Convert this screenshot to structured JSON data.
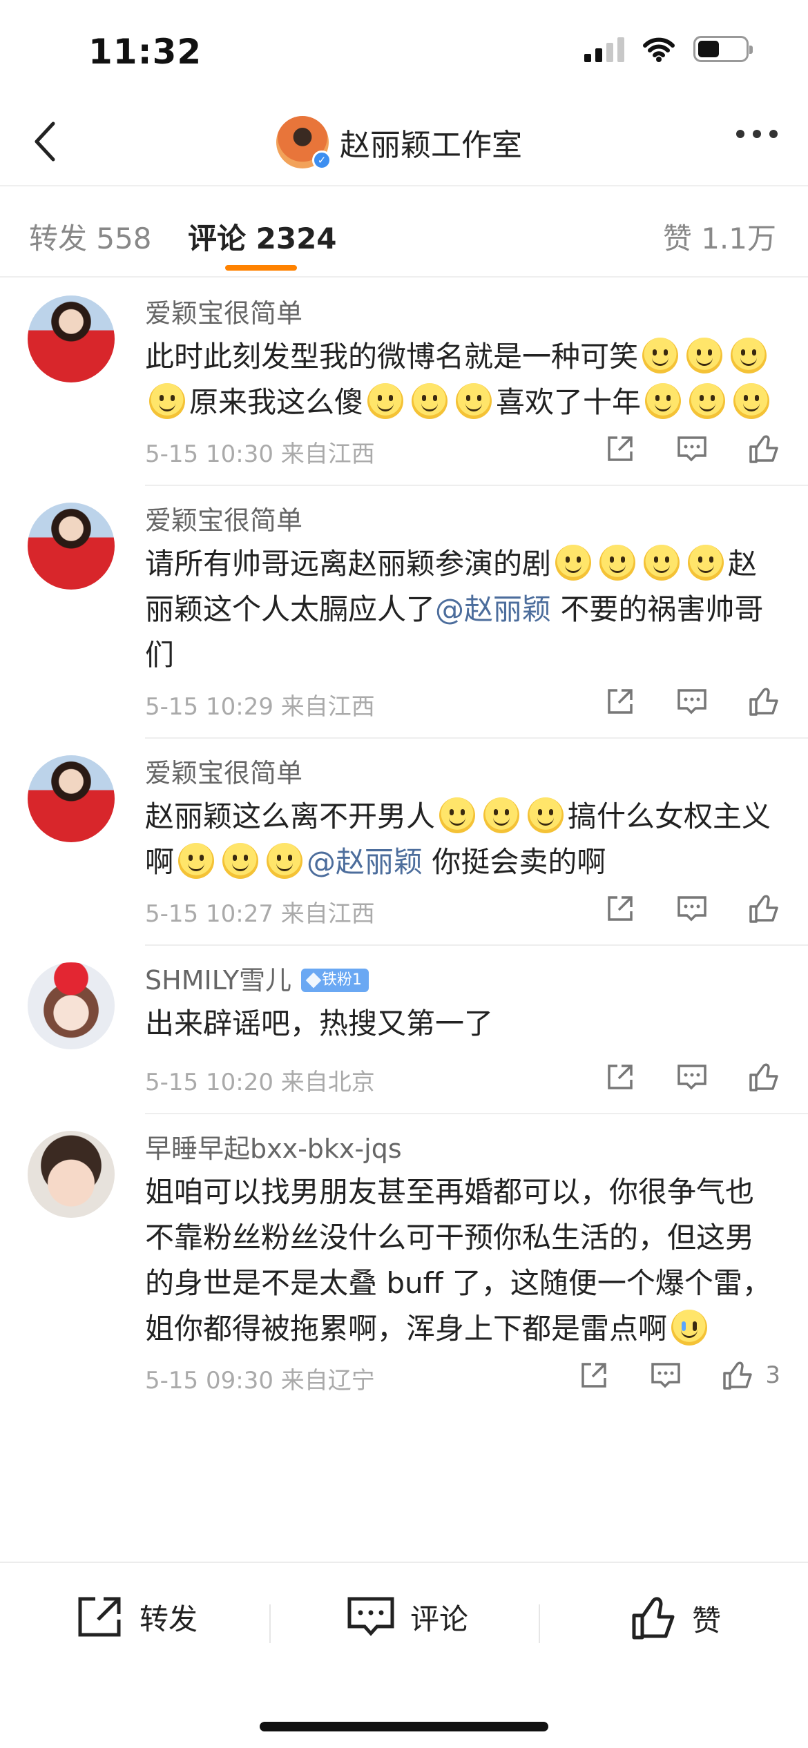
{
  "status_bar": {
    "time": "11:32"
  },
  "header": {
    "title": "赵丽颖工作室"
  },
  "tabs": {
    "forward": "转发 558",
    "comment": "评论 2324",
    "like": "赞 1.1万"
  },
  "comments": [
    {
      "username": "爱颖宝很简单",
      "segments": [
        "此时此刻发型我的微博名就是一种可笑",
        "原来我这么傻",
        "喜欢了十年"
      ],
      "meta": "5-15 10:30  来自江西"
    },
    {
      "username": "爱颖宝很简单",
      "segments": [
        "请所有帅哥远离赵丽颖参演的剧",
        "赵丽颖这个人太膈应人了",
        "@赵丽颖",
        " 不要的祸害帅哥们"
      ],
      "meta": "5-15 10:29  来自江西"
    },
    {
      "username": "爱颖宝很简单",
      "segments": [
        "赵丽颖这么离不开男人",
        "搞什么女权主义啊",
        "@赵丽颖",
        " 你挺会卖的啊"
      ],
      "meta": "5-15 10:27  来自江西"
    },
    {
      "username": "SHMILY雪儿",
      "badge": "铁粉1",
      "segments": [
        "出来辟谣吧，热搜又第一了"
      ],
      "meta": "5-15 10:20  来自北京"
    },
    {
      "username": "早睡早起bxx-bkx-jqs",
      "segments": [
        "姐咱可以找男朋友甚至再婚都可以，你很争气也不靠粉丝粉丝没什么可干预你私生活的，但这男的身世是不是太叠 buff 了，这随便一个爆个雷，姐你都得被拖累啊，浑身上下都是雷点啊"
      ],
      "meta": "5-15 09:30  来自辽宁",
      "like_count": "3"
    }
  ],
  "bottom_bar": {
    "forward": "转发",
    "comment": "评论",
    "like": "赞"
  }
}
